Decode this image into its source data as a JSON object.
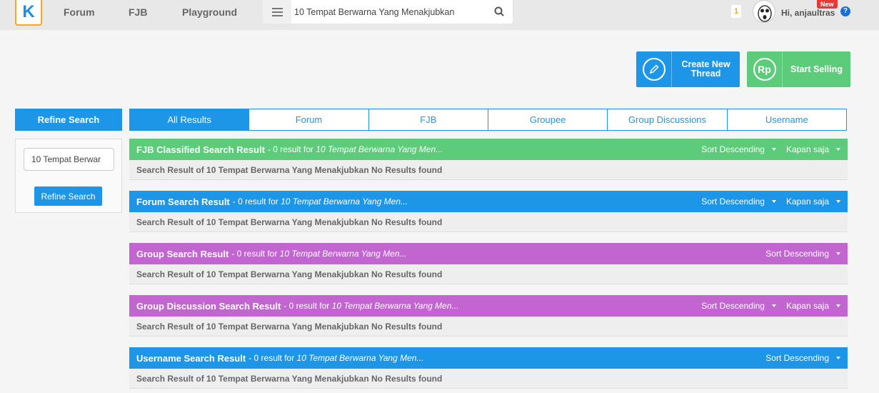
{
  "nav": {
    "logo": "K",
    "forum": "Forum",
    "fjb": "FJB",
    "playground": "Playground"
  },
  "search": {
    "value": "10 Tempat Berwarna Yang Menakjubkan"
  },
  "user": {
    "notif_count": "1",
    "greeting": "Hi, anjaultras",
    "new_badge": "New",
    "help": "?"
  },
  "actions": {
    "create_line1": "Create New",
    "create_line2": "Thread",
    "sell": "Start Selling",
    "rp": "Rp"
  },
  "refine": {
    "title": "Refine Search",
    "input_value": "10 Tempat Berwar",
    "button": "Refine Search"
  },
  "tabs": [
    {
      "label": "All Results"
    },
    {
      "label": "Forum"
    },
    {
      "label": "FJB"
    },
    {
      "label": "Groupee"
    },
    {
      "label": "Group Discussions"
    },
    {
      "label": "Username"
    }
  ],
  "sections": [
    {
      "title": "FJB Classified Search Result",
      "meta": " - 0 result for ",
      "query": "10 Tempat Berwarna Yang Men...",
      "sort": "Sort Descending",
      "time": "Kapan saja",
      "body": "Search Result of 10 Tempat Berwarna Yang Menakjubkan No Results found",
      "color": "#5ccb7a"
    },
    {
      "title": "Forum Search Result",
      "meta": " - 0 result for ",
      "query": "10 Tempat Berwarna Yang Men...",
      "sort": "Sort Descending",
      "time": "Kapan saja",
      "body": "Search Result of 10 Tempat Berwarna Yang Menakjubkan No Results found",
      "color": "#1e96e8"
    },
    {
      "title": "Group Search Result",
      "meta": " - 0 result for ",
      "query": "10 Tempat Berwarna Yang Men...",
      "sort": "Sort Descending",
      "body": "Search Result of 10 Tempat Berwarna Yang Menakjubkan No Results found",
      "color": "#c265d1"
    },
    {
      "title": "Group Discussion Search Result",
      "meta": " - 0 result for ",
      "query": "10 Tempat Berwarna Yang Men...",
      "sort": "Sort Descending",
      "time": "Kapan saja",
      "body": "Search Result of 10 Tempat Berwarna Yang Menakjubkan No Results found",
      "color": "#c265d1"
    },
    {
      "title": "Username Search Result",
      "meta": " - 0 result for ",
      "query": "10 Tempat Berwarna Yang Men...",
      "sort": "Sort Descending",
      "body": "Search Result of 10 Tempat Berwarna Yang Menakjubkan No Results found",
      "color": "#1e96e8"
    }
  ]
}
